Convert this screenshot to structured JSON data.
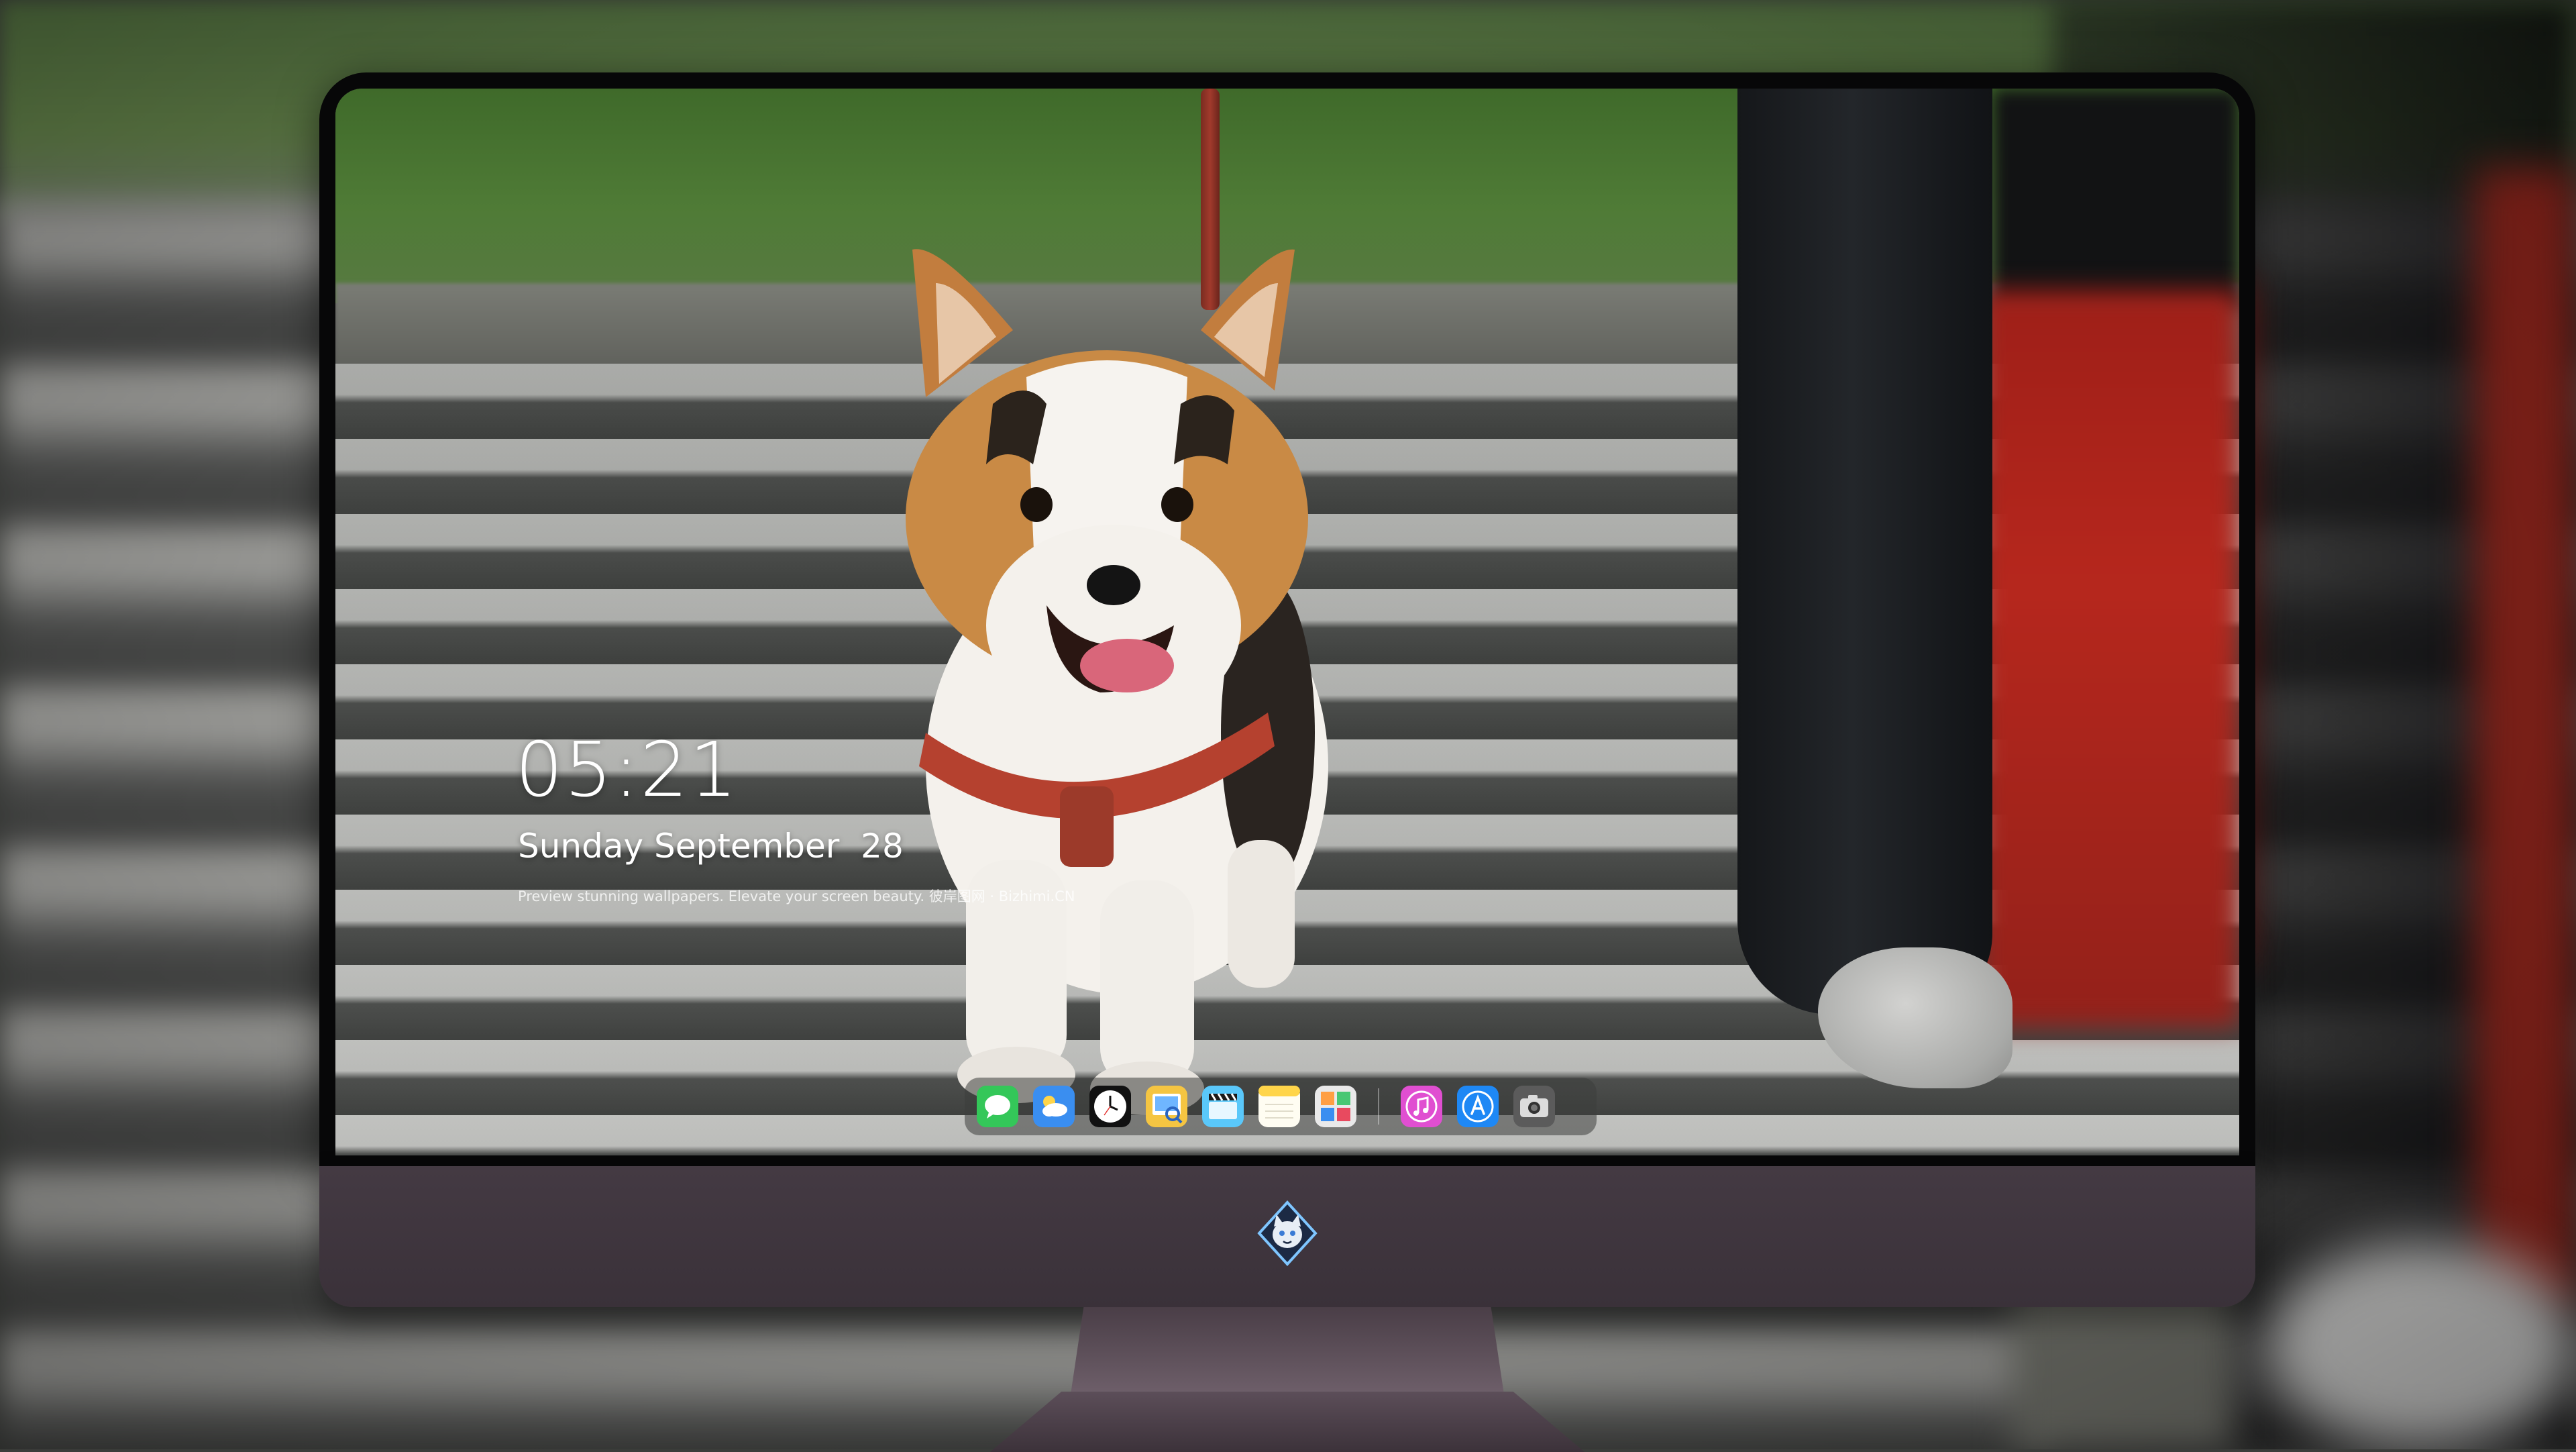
{
  "lockscreen": {
    "time": "05:21",
    "date": "Sunday September  28",
    "caption": "Preview stunning wallpapers. Elevate your screen beauty. 彼岸图网 · Bizhimi.CN"
  },
  "dock": {
    "apps": [
      {
        "name": "Messages",
        "icon": "messages-icon",
        "color": "#34c759"
      },
      {
        "name": "Weather",
        "icon": "weather-icon",
        "color": "#3a8ef0"
      },
      {
        "name": "Clock",
        "icon": "clock-icon",
        "color": "#111111"
      },
      {
        "name": "Preview",
        "icon": "preview-icon",
        "color": "#f5c542"
      },
      {
        "name": "Final Cut",
        "icon": "clapperboard-icon",
        "color": "#5ac8fa"
      },
      {
        "name": "Notes",
        "icon": "notes-icon",
        "color": "#ffd54a"
      },
      {
        "name": "Photo Booth",
        "icon": "photo-grid-icon",
        "color": "#e9e9e9"
      },
      {
        "name": "iTunes",
        "icon": "music-icon",
        "color": "#e04fd1"
      },
      {
        "name": "App Store",
        "icon": "app-store-icon",
        "color": "#1e88f5"
      },
      {
        "name": "Camera",
        "icon": "camera-icon",
        "color": "#5b5b5b"
      }
    ]
  },
  "monitor": {
    "logo_icon": "cat-crest-logo-icon"
  }
}
